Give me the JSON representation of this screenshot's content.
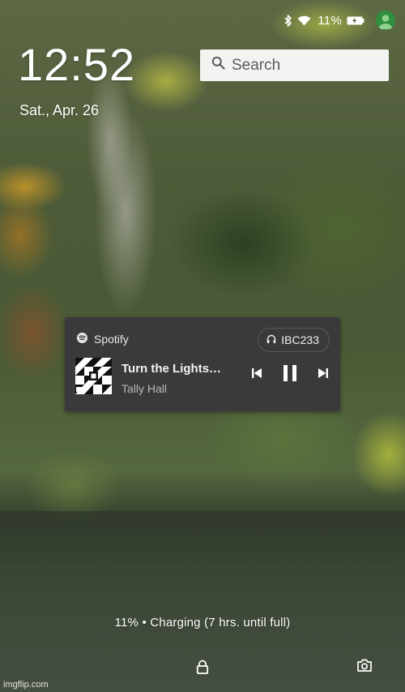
{
  "status_bar": {
    "battery_percent": "11%",
    "icons": [
      "bluetooth-icon",
      "wifi-icon",
      "battery-charging-icon",
      "user-avatar-icon"
    ]
  },
  "lockscreen": {
    "time": "12:52",
    "date": "Sat., Apr. 26"
  },
  "search": {
    "placeholder": "Search"
  },
  "media": {
    "app_name": "Spotify",
    "device": "IBC233",
    "track_title": "Turn the Lights…",
    "artist": "Tally Hall",
    "controls": [
      "previous",
      "pause",
      "next"
    ]
  },
  "charging_status": "11% • Charging (7 hrs. until full)",
  "watermark": "imgflip.com",
  "colors": {
    "card_bg": "#3a3a3c",
    "avatar": "#2f8f3c"
  }
}
